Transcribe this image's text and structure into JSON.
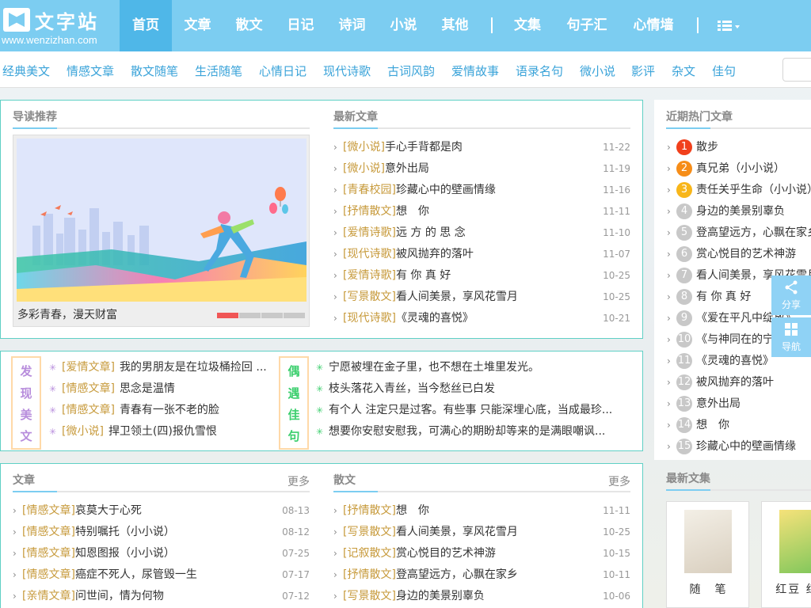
{
  "site": {
    "logo_text": "文字站",
    "logo_url": "www.wenzizhan.com"
  },
  "nav": {
    "items": [
      "首页",
      "文章",
      "散文",
      "日记",
      "诗词",
      "小说",
      "其他"
    ],
    "items2": [
      "文集",
      "句子汇",
      "心情墙"
    ]
  },
  "categories": [
    "经典美文",
    "情感文章",
    "散文随笔",
    "生活随笔",
    "心情日记",
    "现代诗歌",
    "古词风韵",
    "爱情故事",
    "语录名句",
    "微小说",
    "影评",
    "杂文",
    "佳句"
  ],
  "featured": {
    "title": "导读推荐",
    "caption": "多彩青春，漫天财富"
  },
  "latest": {
    "title": "最新文章",
    "rows": [
      {
        "tag": "[微小说]",
        "title": "手心手背都是肉",
        "date": "11-22"
      },
      {
        "tag": "[微小说]",
        "title": "意外出局",
        "date": "11-19"
      },
      {
        "tag": "[青春校园]",
        "title": "珍藏心中的壁画情缘",
        "date": "11-16"
      },
      {
        "tag": "[抒情散文]",
        "title": "想　你",
        "date": "11-11"
      },
      {
        "tag": "[爱情诗歌]",
        "title": "远 方 的 思 念",
        "date": "11-10"
      },
      {
        "tag": "[现代诗歌]",
        "title": "被风抛弃的落叶",
        "date": "11-07"
      },
      {
        "tag": "[爱情诗歌]",
        "title": "有 你 真 好",
        "date": "10-25"
      },
      {
        "tag": "[写景散文]",
        "title": "看人间美景，享风花雪月",
        "date": "10-25"
      },
      {
        "tag": "[现代诗歌]",
        "title": "《灵魂的喜悦》",
        "date": "10-21"
      }
    ]
  },
  "hot": {
    "title": "近期热门文章",
    "rows": [
      {
        "n": "1",
        "title": "散步"
      },
      {
        "n": "2",
        "title": "真兄弟（小小说）"
      },
      {
        "n": "3",
        "title": "责任关乎生命（小小说）"
      },
      {
        "n": "4",
        "title": "身边的美景别辜负"
      },
      {
        "n": "5",
        "title": "登高望远方，心飘在家乡"
      },
      {
        "n": "6",
        "title": "赏心悦目的艺术神游"
      },
      {
        "n": "7",
        "title": "看人间美景，享风花雪月"
      },
      {
        "n": "8",
        "title": "有 你 真 好"
      },
      {
        "n": "9",
        "title": "《爱在平凡中绽放》"
      },
      {
        "n": "10",
        "title": "《与神同在的宁静》"
      },
      {
        "n": "11",
        "title": "《灵魂的喜悦》"
      },
      {
        "n": "12",
        "title": "被风抛弃的落叶"
      },
      {
        "n": "13",
        "title": "意外出局"
      },
      {
        "n": "14",
        "title": "想　你"
      },
      {
        "n": "15",
        "title": "珍藏心中的壁画情缘"
      }
    ]
  },
  "side_buttons": {
    "share": "分享",
    "nav": "导航"
  },
  "collections": {
    "title": "最新文集",
    "books": [
      {
        "title": "随　笔"
      },
      {
        "title": "红豆 红豆"
      }
    ]
  },
  "discover": {
    "label": [
      "发",
      "现",
      "美",
      "文"
    ],
    "rows": [
      {
        "tag": "[爱情文章]",
        "title": "我的男朋友是在垃圾桶捡回 ..."
      },
      {
        "tag": "[情感文章]",
        "title": "思念是温情"
      },
      {
        "tag": "[情感文章]",
        "title": "青春有一张不老的脸"
      },
      {
        "tag": "[微小说]",
        "title": "捍卫领土(四)报仇雪恨"
      }
    ]
  },
  "quotes": {
    "label": [
      "偶",
      "遇",
      "佳",
      "句"
    ],
    "rows": [
      "宁愿被埋在金子里，也不想在土堆里发光。",
      "枝头落花入青丝，当今愁丝已白发",
      "有个人 注定只是过客。有些事 只能深埋心底，当成最珍...",
      "想要你安慰安慰我，可满心的期盼却等来的是满眼嘲讽..."
    ]
  },
  "articles": {
    "title": "文章",
    "more": "更多",
    "rows": [
      {
        "tag": "[情感文章]",
        "title": "哀莫大于心死",
        "date": "08-13"
      },
      {
        "tag": "[情感文章]",
        "title": "特别嘱托（小小说）",
        "date": "08-12"
      },
      {
        "tag": "[情感文章]",
        "title": "知恩图报（小小说）",
        "date": "07-25"
      },
      {
        "tag": "[情感文章]",
        "title": "癌症不死人，尿管毁一生",
        "date": "07-17"
      },
      {
        "tag": "[亲情文章]",
        "title": "问世间，情为何物",
        "date": "07-12"
      }
    ]
  },
  "prose": {
    "title": "散文",
    "more": "更多",
    "rows": [
      {
        "tag": "[抒情散文]",
        "title": "想　你",
        "date": "11-11"
      },
      {
        "tag": "[写景散文]",
        "title": "看人间美景，享风花雪月",
        "date": "10-25"
      },
      {
        "tag": "[记叙散文]",
        "title": "赏心悦目的艺术神游",
        "date": "10-15"
      },
      {
        "tag": "[抒情散文]",
        "title": "登高望远方，心飘在家乡",
        "date": "10-11"
      },
      {
        "tag": "[写景散文]",
        "title": "身边的美景别辜负",
        "date": "10-06"
      }
    ]
  },
  "colors": {
    "nav_bg": "#7ccdf1",
    "nav_active": "#4fb7e8",
    "accent_teal": "#5fd0c5",
    "tag": "#c79a3b",
    "link_blue": "#3aa3d9"
  }
}
